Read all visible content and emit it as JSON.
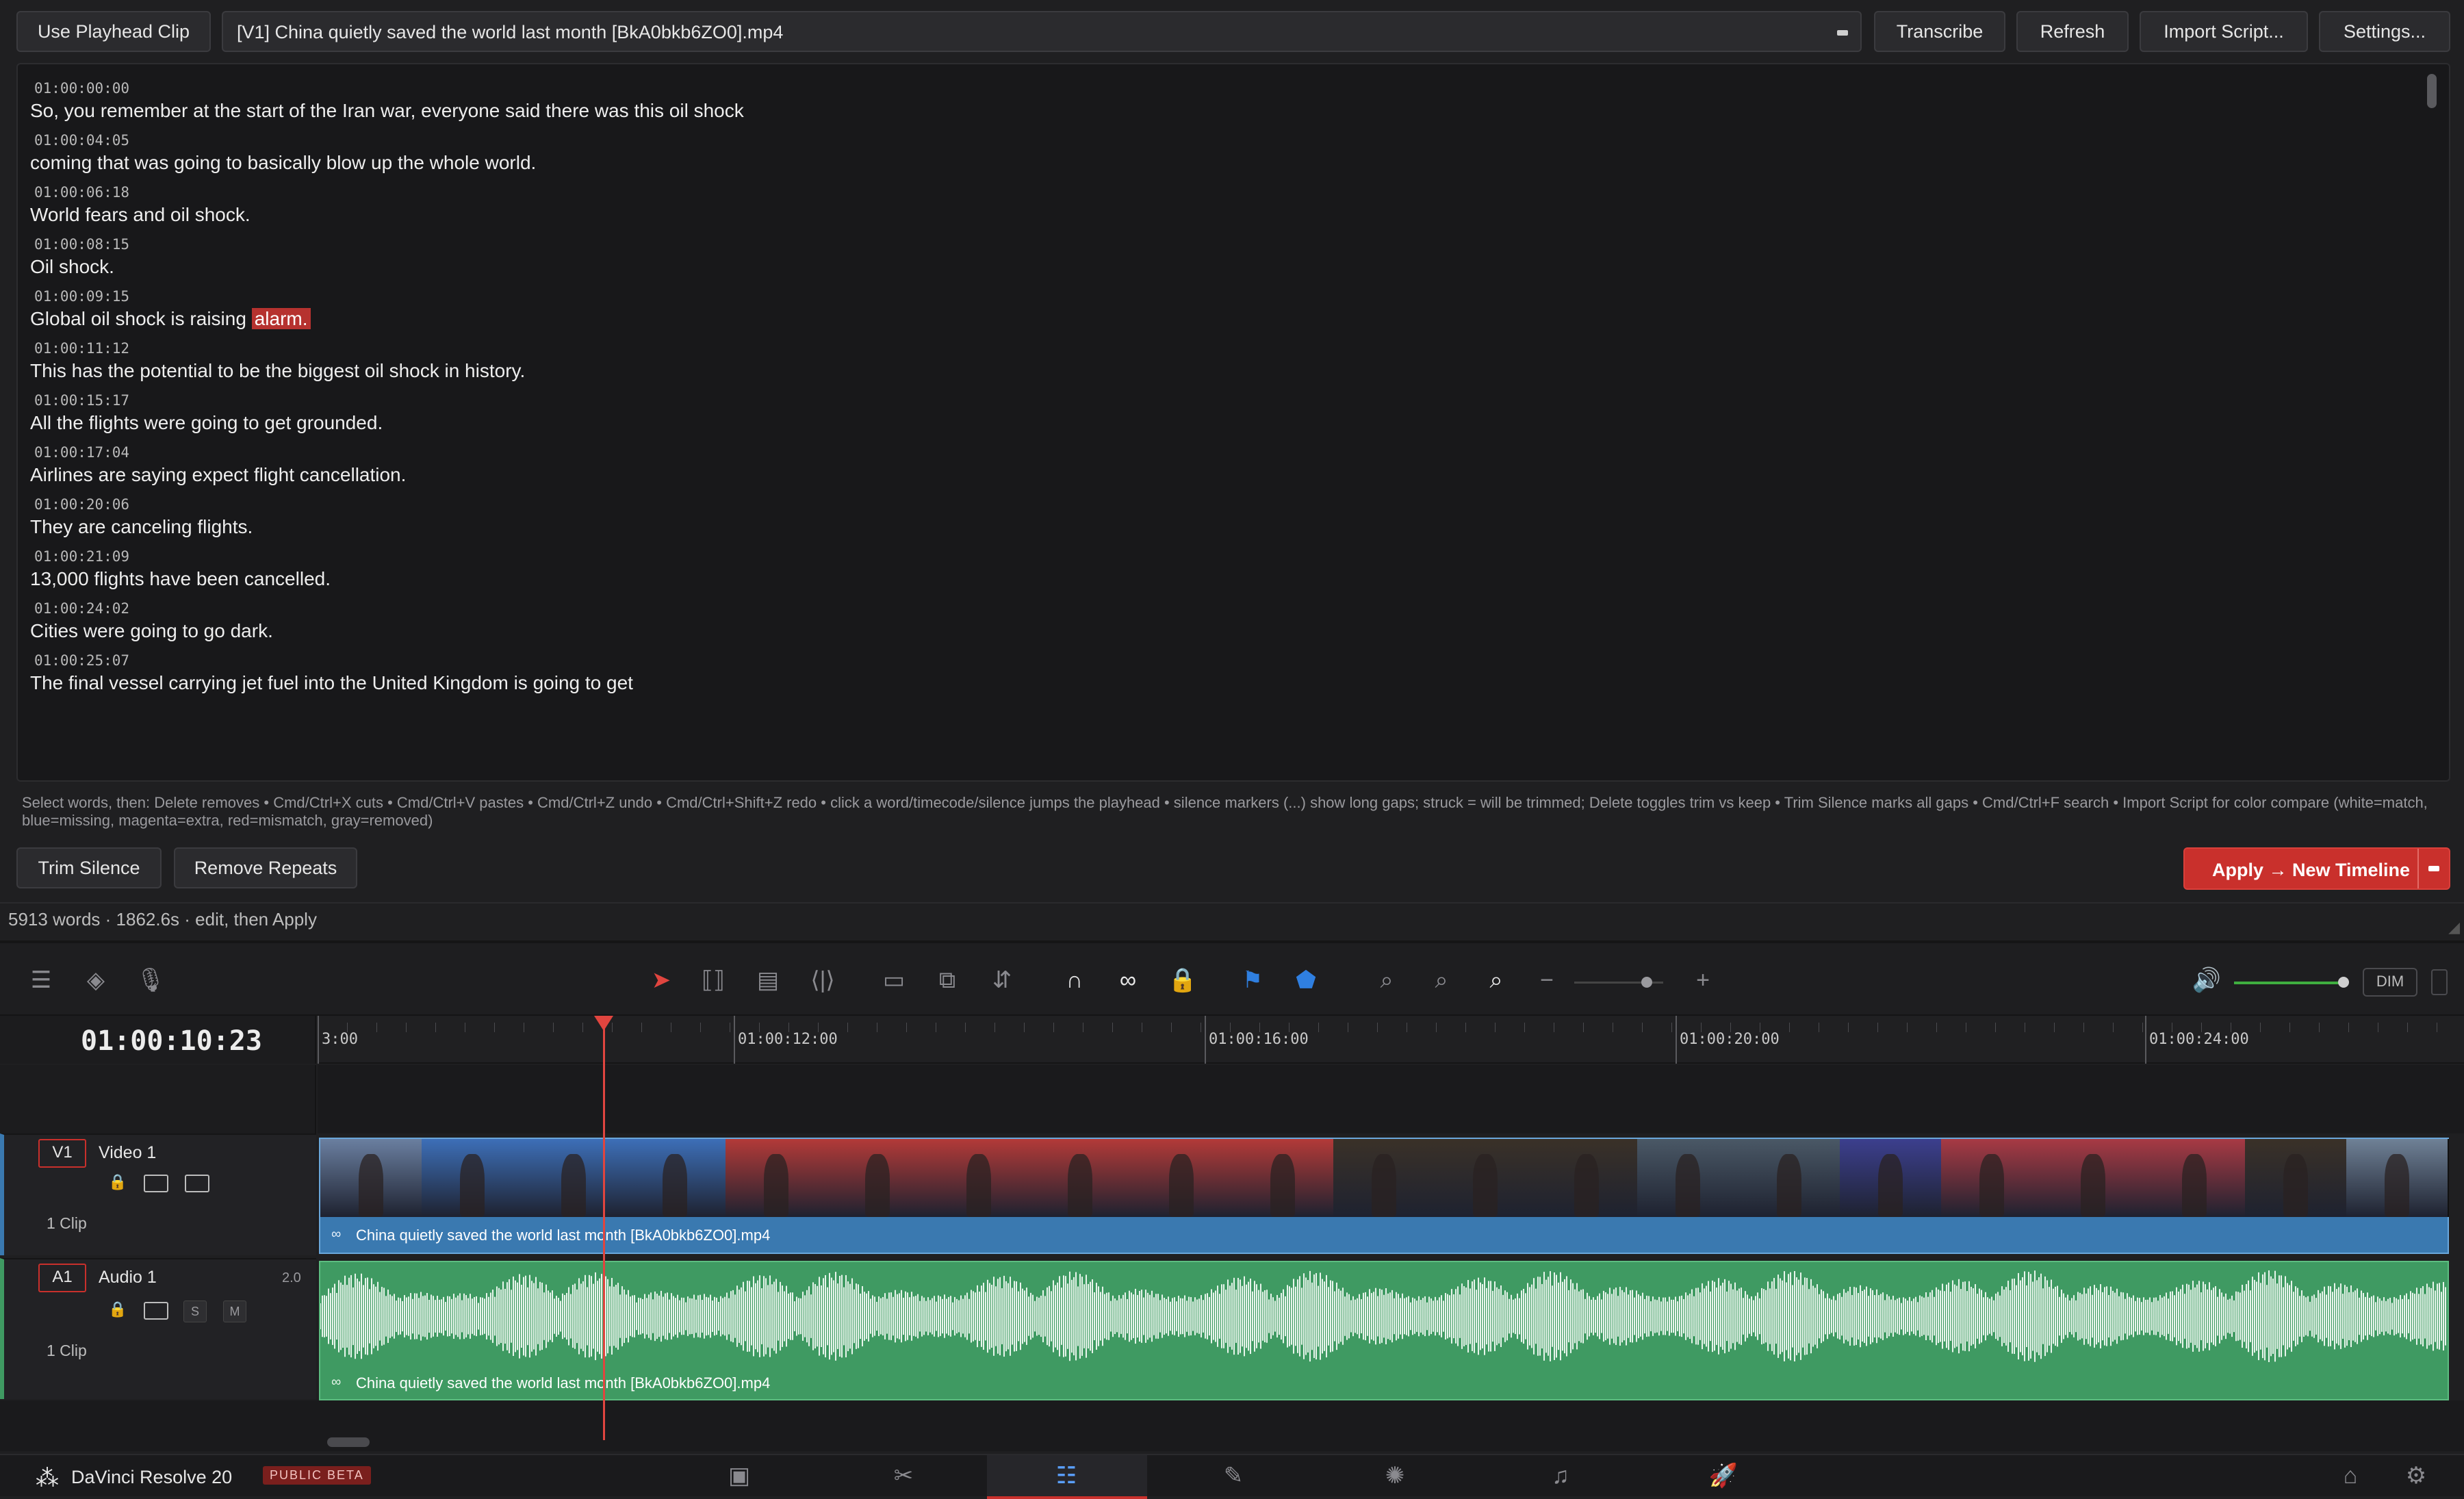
{
  "toolbar": {
    "use_playhead_clip": "Use Playhead Clip",
    "clip_select": "[V1] China quietly saved the world last month [BkA0bkb6ZO0].mp4",
    "transcribe": "Transcribe",
    "refresh": "Refresh",
    "import_script": "Import Script...",
    "settings": "Settings..."
  },
  "transcript": [
    {
      "ts": "01:00:00:00",
      "text": "So, you remember at the start of the Iran war, everyone said there was this oil shock"
    },
    {
      "ts": "01:00:04:05",
      "text": "coming that was going to basically blow up the whole world."
    },
    {
      "ts": "01:00:06:18",
      "text": "World fears and oil shock."
    },
    {
      "ts": "01:00:08:15",
      "text": "Oil shock."
    },
    {
      "ts": "01:00:09:15",
      "text": "Global oil shock is raising",
      "highlight": "alarm."
    },
    {
      "ts": "01:00:11:12",
      "text": "This has the potential to be the biggest oil shock in history."
    },
    {
      "ts": "01:00:15:17",
      "text": "All the flights were going to get grounded."
    },
    {
      "ts": "01:00:17:04",
      "text": "Airlines are saying expect flight cancellation."
    },
    {
      "ts": "01:00:20:06",
      "text": "They are canceling flights."
    },
    {
      "ts": "01:00:21:09",
      "text": "13,000 flights have been cancelled."
    },
    {
      "ts": "01:00:24:02",
      "text": "Cities were going to go dark."
    },
    {
      "ts": "01:00:25:07",
      "text": "The final vessel carrying jet fuel into the United Kingdom is going to get"
    }
  ],
  "help": {
    "text": "Select words, then: Delete removes • Cmd/Ctrl+X cuts • Cmd/Ctrl+V pastes • Cmd/Ctrl+Z undo • Cmd/Ctrl+Shift+Z redo • click a word/timecode/silence jumps the playhead • silence markers (...) show long gaps; struck = will be trimmed; Delete toggles trim vs keep • Trim Silence marks all gaps • Cmd/Ctrl+F search • Import Script for color compare (white=match, blue=missing, magenta=extra, red=mismatch, gray=removed)"
  },
  "actions": {
    "trim_silence": "Trim Silence",
    "remove_repeats": "Remove Repeats",
    "apply": "Apply → New Timeline"
  },
  "status": {
    "text": "5913 words · 1862.6s · edit, then Apply"
  },
  "timeline": {
    "timecode": "01:00:10:23",
    "ruler": [
      "3:00",
      "01:00:12:00",
      "01:00:16:00",
      "01:00:20:00",
      "01:00:24:00"
    ],
    "dim": "DIM",
    "video_track": {
      "id": "V1",
      "name": "Video 1",
      "clips": "1 Clip",
      "clip_name": "China quietly saved the world last month [BkA0bkb6ZO0].mp4"
    },
    "audio_track": {
      "id": "A1",
      "name": "Audio 1",
      "channels": "2.0",
      "clips": "1 Clip",
      "solo": "S",
      "mute": "M",
      "clip_name": "China quietly saved the world last month [BkA0bkb6ZO0].mp4"
    }
  },
  "footer": {
    "app_name": "DaVinci Resolve 20",
    "badge": "PUBLIC BETA"
  },
  "colors": {
    "accent_red": "#c9302c",
    "video_clip": "#3a79b0",
    "audio_clip": "#3f9a62",
    "playhead": "#e0453f"
  }
}
